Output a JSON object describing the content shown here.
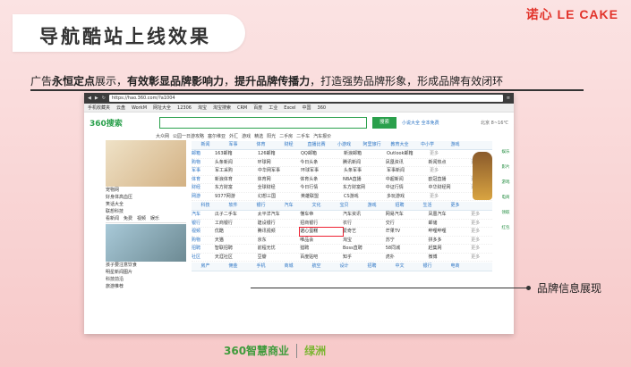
{
  "slide": {
    "title": "导航酷站上线效果",
    "brand": "诺心 LE CAKE",
    "tagline": [
      {
        "t": "广告",
        "b": false
      },
      {
        "t": "永恒定点",
        "b": true
      },
      {
        "t": "展示，",
        "b": false
      },
      {
        "t": "有效彰显品牌影响力",
        "b": true
      },
      {
        "t": "，",
        "b": false
      },
      {
        "t": "提升品牌传播力",
        "b": true
      },
      {
        "t": "，打造强势品牌形象，形成品牌有效闭环",
        "b": false
      }
    ],
    "callout": "品牌信息展现"
  },
  "browser": {
    "url": "https://hao.360.com/?a1004",
    "bookmarks": [
      "手机收藏夹",
      "云盘",
      "WorkM",
      "网址大全",
      "12306",
      "淘宝",
      "淘宝搜索",
      "CRM",
      "百度",
      "工业",
      "Excel",
      "中国",
      "360"
    ],
    "logo": "360搜索",
    "search_button": "搜索",
    "search_hint": "小说大全 全本免费",
    "weather": "北京 8~16℃",
    "hot": [
      "大众网",
      "公园一日游攻略",
      "塞尔维亚",
      "外汇",
      "游戏",
      "精选",
      "阳光",
      "二手房",
      "二手车",
      "汽车报价"
    ]
  },
  "left": {
    "links": [
      "宠物网",
      "好身体高血压",
      "笑话大全",
      "联想科技"
    ],
    "tabs": [
      "看新闻",
      "免费",
      "视频",
      "娱乐"
    ],
    "news": [
      "孩子要注意饮食",
      "明星新闻图片",
      "科技前沿",
      "旅游推荐"
    ]
  },
  "grid": {
    "sections": [
      {
        "head": [
          "新闻",
          "军事",
          "体育",
          "财经",
          "直播比赛",
          "小游戏",
          "阿里旅行",
          "教育大全",
          "中小学",
          "游戏"
        ],
        "rows": [
          [
            "邮箱",
            "163邮箱",
            "126邮箱",
            "QQ邮箱",
            "新浪邮箱",
            "Outlook邮箱",
            "更多"
          ],
          [
            "购物",
            "头条新闻",
            "环球网",
            "今日头条",
            "腾讯新闻",
            "凤凰资讯",
            "新闻热点",
            "更多"
          ],
          [
            "军事",
            "军工采购",
            "中华网军事",
            "环球军事",
            "头条军事",
            "军事新闻",
            "更多"
          ],
          [
            "体育",
            "新浪体育",
            "体育网",
            "体育头条",
            "NBA直播",
            "中超新闻",
            "欧冠直播",
            "更多"
          ],
          [
            "财经",
            "东方财富",
            "全球财经",
            "今日行情",
            "东方财富网",
            "中证行情",
            "中华财经网",
            "更多"
          ],
          [
            "网游",
            "9377网游",
            "幻想三国",
            "英雄联盟",
            "CS游戏",
            "多玩游戏",
            "更多"
          ]
        ]
      },
      {
        "head": [
          "科技",
          "软件",
          "银行",
          "汽车",
          "文化",
          "宝贝",
          "游戏",
          "招聘",
          "生活",
          "更多"
        ],
        "rows": [
          [
            "汽车",
            "瓜子二手车",
            "太平洋汽车",
            "懂车帝",
            "汽车资讯",
            "网易汽车",
            "凤凰汽车",
            "更多"
          ],
          [
            "银行",
            "工商银行",
            "建设银行",
            "招商银行",
            "农行",
            "交行",
            "邮储",
            "更多"
          ],
          [
            "视频",
            "优酷",
            "腾讯视频",
            "诺心蛋糕",
            "爱奇艺",
            "芒果TV",
            "哔哩哔哩",
            "更多"
          ],
          [
            "购物",
            "天猫",
            "京东",
            "唯品会",
            "淘宝",
            "苏宁",
            "拼多多",
            "更多"
          ],
          [
            "招聘",
            "智联招聘",
            "前程无忧",
            "猎聘",
            "Boss直聘",
            "58同城",
            "赶集网",
            "更多"
          ],
          [
            "社区",
            "天涯社区",
            "豆瓣",
            "百度贴吧",
            "知乎",
            "虎扑",
            "微博",
            "更多"
          ]
        ]
      }
    ],
    "footer": [
      "房产",
      "佣金",
      "手机",
      "商城",
      "航空",
      "设计",
      "招聘",
      "中文",
      "银行",
      "电商"
    ]
  },
  "rightbar": [
    "娱乐",
    "影片",
    "游戏",
    "电商",
    "领取",
    "红包"
  ],
  "footer_logos": {
    "a": "360智慧商业",
    "b": "绿洲"
  }
}
